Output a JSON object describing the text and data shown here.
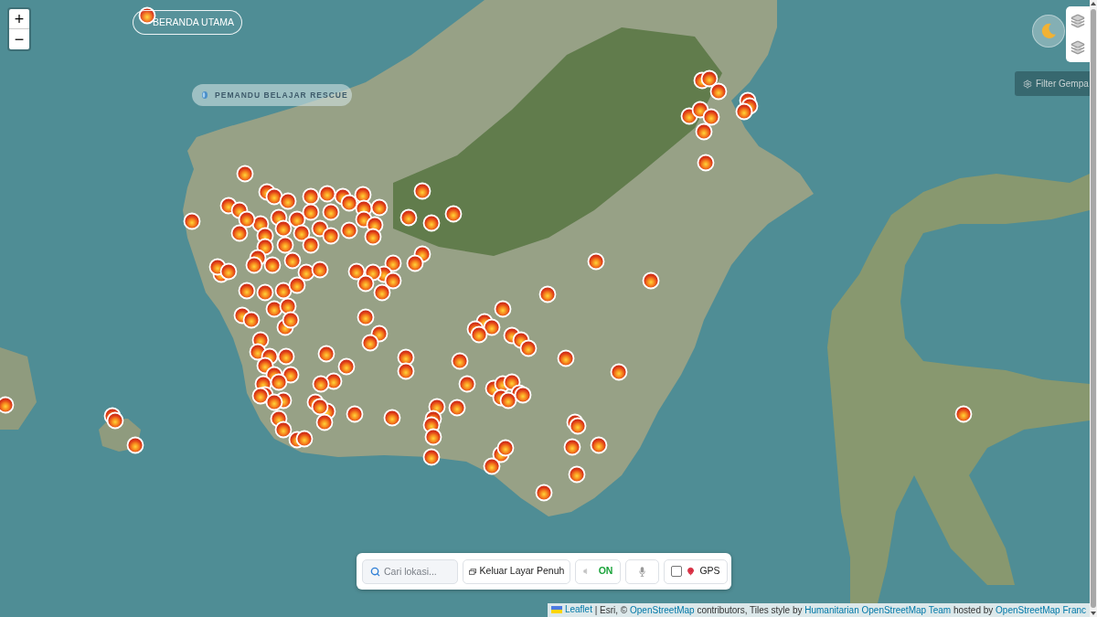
{
  "zoom_control": {
    "zoom_in": "+",
    "zoom_out": "−"
  },
  "home_button": {
    "label": "BERANDA UTAMA"
  },
  "guide_button": {
    "label": "PEMANDU BELAJAR RESCUE"
  },
  "filter_button": {
    "label": "Filter Gempa"
  },
  "toolbar": {
    "search": {
      "placeholder": "Cari lokasi..."
    },
    "fullscreen_button": {
      "label": "Keluar Layar Penuh"
    },
    "sound_button": {
      "label": "ON",
      "on": true
    },
    "gps": {
      "label": "GPS",
      "checked": false
    }
  },
  "attribution": [
    {
      "kind": "flag_link",
      "text": "Leaflet"
    },
    {
      "kind": "text",
      "text": " | Esri, © "
    },
    {
      "kind": "link",
      "text": "OpenStreetMap"
    },
    {
      "kind": "text",
      "text": " contributors, Tiles style by "
    },
    {
      "kind": "link",
      "text": "Humanitarian OpenStreetMap Team"
    },
    {
      "kind": "text",
      "text": " hosted by "
    },
    {
      "kind": "link",
      "text": "OpenStreetMap Franc"
    }
  ]
}
